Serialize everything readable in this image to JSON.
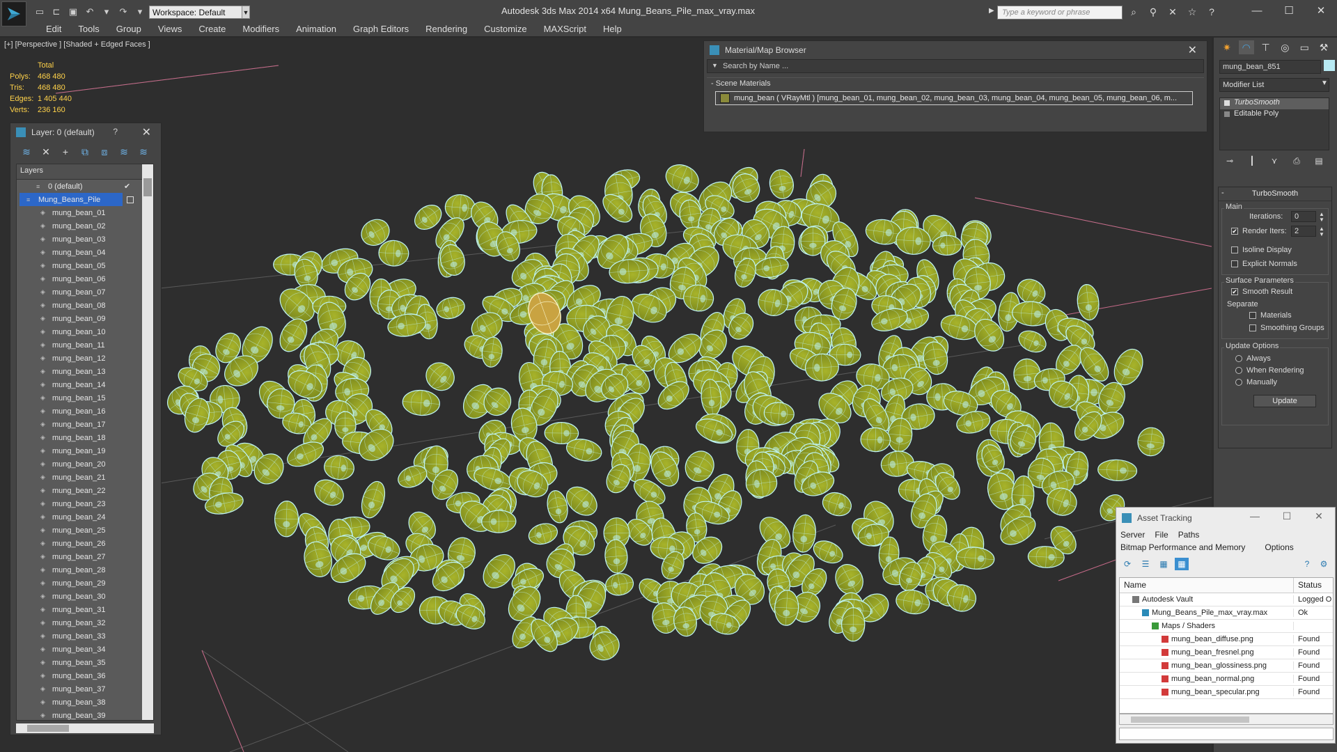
{
  "app": {
    "title": "Autodesk 3ds Max  2014 x64      Mung_Beans_Pile_max_vray.max",
    "workspace": "Workspace: Default",
    "search_placeholder": "Type a keyword or phrase"
  },
  "menu": [
    "Edit",
    "Tools",
    "Group",
    "Views",
    "Create",
    "Modifiers",
    "Animation",
    "Graph Editors",
    "Rendering",
    "Customize",
    "MAXScript",
    "Help"
  ],
  "viewport": {
    "label": "[+] [Perspective ] [Shaded + Edged Faces ]",
    "stats_header": "Total",
    "stats": [
      {
        "label": "Polys:",
        "value": "468 480"
      },
      {
        "label": "Tris:",
        "value": "468 480"
      },
      {
        "label": "Edges:",
        "value": "1 405 440"
      },
      {
        "label": "Verts:",
        "value": "236 160"
      }
    ]
  },
  "layer_panel": {
    "title": "Layer: 0 (default)",
    "help": "?",
    "list_header": "Layers",
    "layers": [
      {
        "name": "0 (default)",
        "kind": "layer"
      },
      {
        "name": "Mung_Beans_Pile",
        "kind": "layer-selected"
      },
      {
        "name": "mung_bean_01",
        "kind": "obj"
      },
      {
        "name": "mung_bean_02",
        "kind": "obj"
      },
      {
        "name": "mung_bean_03",
        "kind": "obj"
      },
      {
        "name": "mung_bean_04",
        "kind": "obj"
      },
      {
        "name": "mung_bean_05",
        "kind": "obj"
      },
      {
        "name": "mung_bean_06",
        "kind": "obj"
      },
      {
        "name": "mung_bean_07",
        "kind": "obj"
      },
      {
        "name": "mung_bean_08",
        "kind": "obj"
      },
      {
        "name": "mung_bean_09",
        "kind": "obj"
      },
      {
        "name": "mung_bean_10",
        "kind": "obj"
      },
      {
        "name": "mung_bean_11",
        "kind": "obj"
      },
      {
        "name": "mung_bean_12",
        "kind": "obj"
      },
      {
        "name": "mung_bean_13",
        "kind": "obj"
      },
      {
        "name": "mung_bean_14",
        "kind": "obj"
      },
      {
        "name": "mung_bean_15",
        "kind": "obj"
      },
      {
        "name": "mung_bean_16",
        "kind": "obj"
      },
      {
        "name": "mung_bean_17",
        "kind": "obj"
      },
      {
        "name": "mung_bean_18",
        "kind": "obj"
      },
      {
        "name": "mung_bean_19",
        "kind": "obj"
      },
      {
        "name": "mung_bean_20",
        "kind": "obj"
      },
      {
        "name": "mung_bean_21",
        "kind": "obj"
      },
      {
        "name": "mung_bean_22",
        "kind": "obj"
      },
      {
        "name": "mung_bean_23",
        "kind": "obj"
      },
      {
        "name": "mung_bean_24",
        "kind": "obj"
      },
      {
        "name": "mung_bean_25",
        "kind": "obj"
      },
      {
        "name": "mung_bean_26",
        "kind": "obj"
      },
      {
        "name": "mung_bean_27",
        "kind": "obj"
      },
      {
        "name": "mung_bean_28",
        "kind": "obj"
      },
      {
        "name": "mung_bean_29",
        "kind": "obj"
      },
      {
        "name": "mung_bean_30",
        "kind": "obj"
      },
      {
        "name": "mung_bean_31",
        "kind": "obj"
      },
      {
        "name": "mung_bean_32",
        "kind": "obj"
      },
      {
        "name": "mung_bean_33",
        "kind": "obj"
      },
      {
        "name": "mung_bean_34",
        "kind": "obj"
      },
      {
        "name": "mung_bean_35",
        "kind": "obj"
      },
      {
        "name": "mung_bean_36",
        "kind": "obj"
      },
      {
        "name": "mung_bean_37",
        "kind": "obj"
      },
      {
        "name": "mung_bean_38",
        "kind": "obj"
      },
      {
        "name": "mung_bean_39",
        "kind": "obj"
      }
    ]
  },
  "material_browser": {
    "title": "Material/Map Browser",
    "search": "Search by Name ...",
    "section": "- Scene Materials",
    "row": "mung_bean  ( VRayMtl )  [mung_bean_01, mung_bean_02, mung_bean_03, mung_bean_04, mung_bean_05, mung_bean_06, m..."
  },
  "command_panel": {
    "object_name": "mung_bean_851",
    "modifier_list": "Modifier List",
    "stack": [
      "TurboSmooth",
      "Editable Poly"
    ],
    "rollout_title": "TurboSmooth",
    "main_label": "Main",
    "iterations_label": "Iterations:",
    "iterations_value": "0",
    "render_iters_label": "Render Iters:",
    "render_iters_value": "2",
    "isoline": "Isoline Display",
    "explicit_normals": "Explicit Normals",
    "surface_params": "Surface Parameters",
    "smooth_result": "Smooth Result",
    "separate": "Separate",
    "materials": "Materials",
    "smoothing_groups": "Smoothing Groups",
    "update_options": "Update Options",
    "always": "Always",
    "when_rendering": "When Rendering",
    "manually": "Manually",
    "update_btn": "Update"
  },
  "asset_tracking": {
    "title": "Asset Tracking",
    "menu1": [
      "Server",
      "File",
      "Paths"
    ],
    "menu2": [
      "Bitmap Performance and Memory",
      "Options"
    ],
    "col_name": "Name",
    "col_status": "Status",
    "rows": [
      {
        "name": "Autodesk Vault",
        "status": "Logged O",
        "indent": 1,
        "icon": "vault"
      },
      {
        "name": "Mung_Beans_Pile_max_vray.max",
        "status": "Ok",
        "indent": 2,
        "icon": "max"
      },
      {
        "name": "Maps / Shaders",
        "status": "",
        "indent": 3,
        "icon": "maps"
      },
      {
        "name": "mung_bean_diffuse.png",
        "status": "Found",
        "indent": 4,
        "icon": "png"
      },
      {
        "name": "mung_bean_fresnel.png",
        "status": "Found",
        "indent": 4,
        "icon": "png"
      },
      {
        "name": "mung_bean_glossiness.png",
        "status": "Found",
        "indent": 4,
        "icon": "png"
      },
      {
        "name": "mung_bean_normal.png",
        "status": "Found",
        "indent": 4,
        "icon": "png"
      },
      {
        "name": "mung_bean_specular.png",
        "status": "Found",
        "indent": 4,
        "icon": "png"
      }
    ]
  },
  "colors": {
    "bean_fill": "#7d8a1e",
    "bean_light": "#a7b32a",
    "wire": "#bff4f5",
    "stats_text": "#ffd24a",
    "selection": "#2c67c8"
  }
}
